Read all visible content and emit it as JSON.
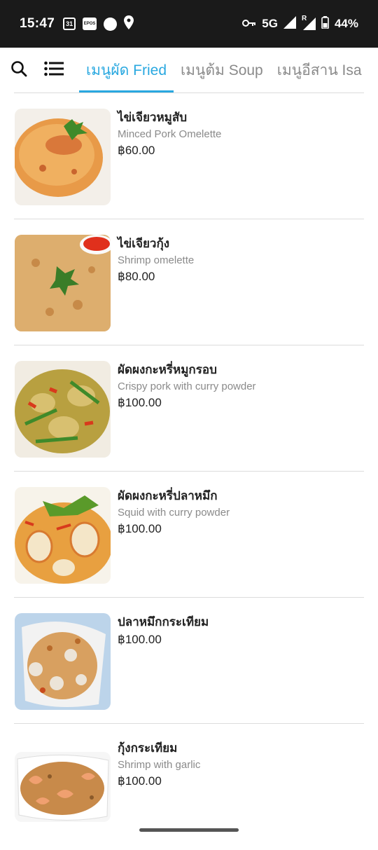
{
  "status": {
    "time": "15:47",
    "calendar_day": "31",
    "epos_label": "EPOS",
    "network": "5G",
    "roaming": "R",
    "battery": "44%"
  },
  "tabs": [
    {
      "label": "เมนูผัด Fried",
      "active": true
    },
    {
      "label": "เมนูต้ม Soup",
      "active": false
    },
    {
      "label": "เมนูอีสาน Isa",
      "active": false
    }
  ],
  "icons": {
    "search": "search-icon",
    "menu": "list-menu-icon"
  },
  "colors": {
    "accent": "#29a8e0",
    "status_bar": "#1a1a1a"
  },
  "items": [
    {
      "name": "ไข่เจียวหมูสับ",
      "desc": "Minced Pork Omelette",
      "price": "฿60.00"
    },
    {
      "name": "ไข่เจียวกุ้ง",
      "desc": "Shrimp omelette",
      "price": "฿80.00"
    },
    {
      "name": "ผัดผงกะหรี่หมูกรอบ",
      "desc": "Crispy pork with curry powder",
      "price": "฿100.00"
    },
    {
      "name": "ผัดผงกะหรี่ปลาหมึก",
      "desc": "Squid with curry powder",
      "price": "฿100.00"
    },
    {
      "name": "ปลาหมึกกระเทียม",
      "desc": "",
      "price": "฿100.00"
    },
    {
      "name": "กุ้งกระเทียม",
      "desc": "Shrimp with garlic",
      "price": "฿100.00"
    }
  ]
}
